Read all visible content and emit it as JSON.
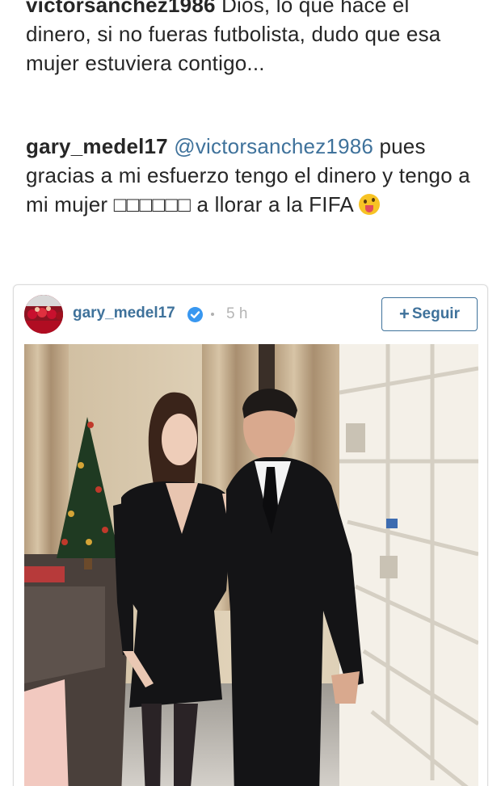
{
  "comments": [
    {
      "user": "victorsanchez1986",
      "text": " Dios, lo que hace el dinero, si no fueras futbolista, dudo que esa mujer estuviera contigo..."
    },
    {
      "user": "gary_medel17",
      "mention": " @victorsanchez1986",
      "text": " pues gracias a mi esfuerzo tengo el dinero y tengo a mi mujer □□□□□□ a llorar a la FIFA ",
      "emoji": "tongue-out-wink-emoji"
    }
  ],
  "post": {
    "username": "gary_medel17",
    "verified_icon": "verified-badge-icon",
    "time": "5 h",
    "follow_plus": "+",
    "follow_label": "Seguir",
    "accent_color": "#3f729b",
    "badge_color": "#3897f0",
    "photo_subject": "couple-in-formal-attire-photo"
  }
}
